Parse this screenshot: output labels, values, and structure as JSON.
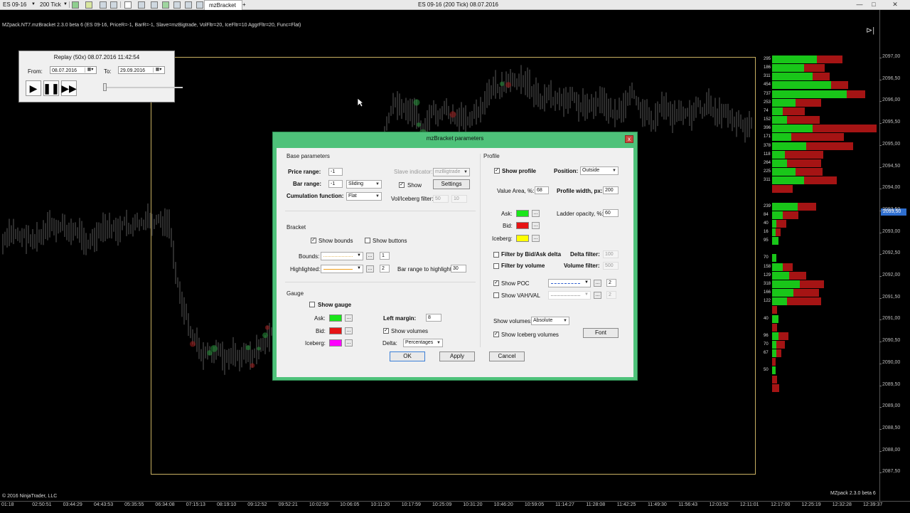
{
  "window": {
    "title": "ES 09-16 (200 Tick)  08.07.2016",
    "instrument": "ES 09-16",
    "period": "200 Tick",
    "tab_label": "mzBracket",
    "add_tab": "+",
    "minimize": "—",
    "maximize": "□",
    "close": "✕",
    "info_line": "MZpack.NT7.mzBracket 2.3.0 beta 6 (ES 09-16, PriceR=-1, BarR=-1, Slave=mzBigtrade, VolFltr=20, IceFltr=10 AggrFltr=20, Func=Flat)"
  },
  "replay": {
    "title": "Replay (50x) 08.07.2016 11:42:54",
    "from_label": "From:",
    "from_value": "08.07.2016",
    "to_label": "To:",
    "to_value": "29.09.2016",
    "position": 0.0
  },
  "price_axis": {
    "labels": [
      "2097,00",
      "2096,50",
      "2096,00",
      "2095,50",
      "2095,00",
      "2094,50",
      "2094,00",
      "2093,50",
      "2093,00",
      "2092,50",
      "2092,00",
      "2091,50",
      "2091,00",
      "2090,50",
      "2090,00",
      "2089,50",
      "2089,00",
      "2088,50",
      "2088,00",
      "2087,50"
    ],
    "current": "2093,50"
  },
  "time_axis": {
    "labels": [
      "01:18",
      "02:50:51",
      "03:44:29",
      "04:43:53",
      "05:35:55",
      "06:34:08",
      "07:15:13",
      "08:19:10",
      "09:12:52",
      "09:52:21",
      "10:02:59",
      "10:06:05",
      "10:11:20",
      "10:17:59",
      "10:25:09",
      "10:31:20",
      "10:46:20",
      "10:59:05",
      "11:14:27",
      "11:28:08",
      "11:42:25",
      "11:49:30",
      "11:56:43",
      "12:03:52",
      "12:11:01",
      "12:17:00",
      "12:25:19",
      "12:32:28",
      "12:39:37"
    ]
  },
  "footer": {
    "copyright": "© 2016 NinjaTrader, LLC",
    "version": "MZpack 2.3.0 beta 6"
  },
  "dialog": {
    "title": "mzBracket parameters",
    "close": "x",
    "base": {
      "header": "Base parameters",
      "price_range_label": "Price range:",
      "price_range_value": "-1",
      "bar_range_label": "Bar range:",
      "bar_range_value": "-1",
      "bar_range_mode": "Sliding",
      "cumulation_label": "Cumulation function:",
      "cumulation_value": "Flat",
      "slave_label": "Slave indicator:",
      "slave_value": "mzBigtrade",
      "show_label": "Show",
      "settings_button": "Settings",
      "filter_label": "Vol/Iceberg filter:",
      "filter_vol": "50",
      "filter_ice": "10"
    },
    "bracket": {
      "header": "Bracket",
      "show_bounds": "Show bounds",
      "show_buttons": "Show buttons",
      "bounds_label": "Bounds:",
      "bounds_width": "1",
      "highlighted_label": "Highlighted:",
      "highlighted_width": "2",
      "bar_range_highlight_label": "Bar range to highlight:",
      "bar_range_highlight_value": "30"
    },
    "gauge": {
      "header": "Gauge",
      "show_gauge": "Show gauge",
      "ask_label": "Ask:",
      "bid_label": "Bid:",
      "iceberg_label": "Iceberg:",
      "left_margin_label": "Left margin:",
      "left_margin_value": "8",
      "show_volumes": "Show volumes",
      "delta_label": "Delta:",
      "delta_value": "Percentages"
    },
    "profile": {
      "header": "Profile",
      "show_profile": "Show profile",
      "position_label": "Position:",
      "position_value": "Outside",
      "value_area_label": "Value Area, %:",
      "value_area_value": "68",
      "profile_width_label": "Profile width, px:",
      "profile_width_value": "200",
      "ask_label": "Ask:",
      "bid_label": "Bid:",
      "iceberg_label": "Iceberg:",
      "ladder_opacity_label": "Ladder opacity, %:",
      "ladder_opacity_value": "60",
      "filter_bidask_label": "Filter by Bid/Ask delta",
      "delta_filter_label": "Delta filter:",
      "delta_filter_value": "100",
      "filter_volume_label": "Filter by volume",
      "volume_filter_label": "Volume filter:",
      "volume_filter_value": "500",
      "show_poc": "Show POC",
      "poc_width": "2",
      "show_vahval": "Show VAH/VAL",
      "vahval_width": "2",
      "show_volumes_label": "Show volumes:",
      "show_volumes_value": "Absolute",
      "show_iceberg_volumes": "Show Iceberg volumes",
      "font_button": "Font"
    },
    "ok": "OK",
    "apply": "Apply",
    "cancel": "Cancel"
  },
  "colors": {
    "ask": "#19e619",
    "bid": "#e61414",
    "iceberg_profile": "#ffff00",
    "iceberg_gauge": "#ff00ff",
    "dialog_frame": "#4ec27a",
    "bracket": "#c8b062"
  },
  "ladder": [
    {
      "label": "295",
      "ask": 0.42,
      "bid": 0.3
    },
    {
      "label": "186",
      "ask": 0.3,
      "bid": 0.24
    },
    {
      "label": "311",
      "ask": 0.38,
      "bid": 0.2
    },
    {
      "label": "454",
      "ask": 0.55,
      "bid": 0.2
    },
    {
      "label": "737",
      "ask": 0.7,
      "bid": 0.22
    },
    {
      "label": "253",
      "ask": 0.22,
      "bid": 0.3
    },
    {
      "label": "74",
      "ask": 0.1,
      "bid": 0.26
    },
    {
      "label": "152",
      "ask": 0.14,
      "bid": 0.38
    },
    {
      "label": "396",
      "ask": 0.38,
      "bid": 0.75
    },
    {
      "label": "171",
      "ask": 0.18,
      "bid": 0.62
    },
    {
      "label": "378",
      "ask": 0.32,
      "bid": 0.55
    },
    {
      "label": "118",
      "ask": 0.12,
      "bid": 0.45
    },
    {
      "label": "264",
      "ask": 0.14,
      "bid": 0.4
    },
    {
      "label": "225",
      "ask": 0.22,
      "bid": 0.32
    },
    {
      "label": "311",
      "ask": 0.3,
      "bid": 0.38
    },
    {
      "label": "",
      "ask": 0.0,
      "bid": 0.24
    },
    {
      "label": "",
      "ask": 0.0,
      "bid": 0.0
    },
    {
      "label": "239",
      "ask": 0.24,
      "bid": 0.22
    },
    {
      "label": "84",
      "ask": 0.1,
      "bid": 0.18
    },
    {
      "label": "40",
      "ask": 0.04,
      "bid": 0.12
    },
    {
      "label": "16",
      "ask": 0.03,
      "bid": 0.06
    },
    {
      "label": "95",
      "ask": 0.06,
      "bid": 0.0
    },
    {
      "label": "",
      "ask": 0.0,
      "bid": 0.0
    },
    {
      "label": "70",
      "ask": 0.04,
      "bid": 0.0
    },
    {
      "label": "158",
      "ask": 0.1,
      "bid": 0.12
    },
    {
      "label": "129",
      "ask": 0.16,
      "bid": 0.2
    },
    {
      "label": "318",
      "ask": 0.26,
      "bid": 0.28
    },
    {
      "label": "166",
      "ask": 0.2,
      "bid": 0.3
    },
    {
      "label": "122",
      "ask": 0.14,
      "bid": 0.4
    },
    {
      "label": "",
      "ask": 0.0,
      "bid": 0.06
    },
    {
      "label": "40",
      "ask": 0.06,
      "bid": 0.0
    },
    {
      "label": "",
      "ask": 0.0,
      "bid": 0.06
    },
    {
      "label": "96",
      "ask": 0.06,
      "bid": 0.12
    },
    {
      "label": "70",
      "ask": 0.04,
      "bid": 0.1
    },
    {
      "label": "67",
      "ask": 0.04,
      "bid": 0.06
    },
    {
      "label": "",
      "ask": 0.0,
      "bid": 0.04
    },
    {
      "label": "50",
      "ask": 0.03,
      "bid": 0.0
    },
    {
      "label": "",
      "ask": 0.0,
      "bid": 0.06
    },
    {
      "label": "",
      "ask": 0.0,
      "bid": 0.08
    }
  ]
}
